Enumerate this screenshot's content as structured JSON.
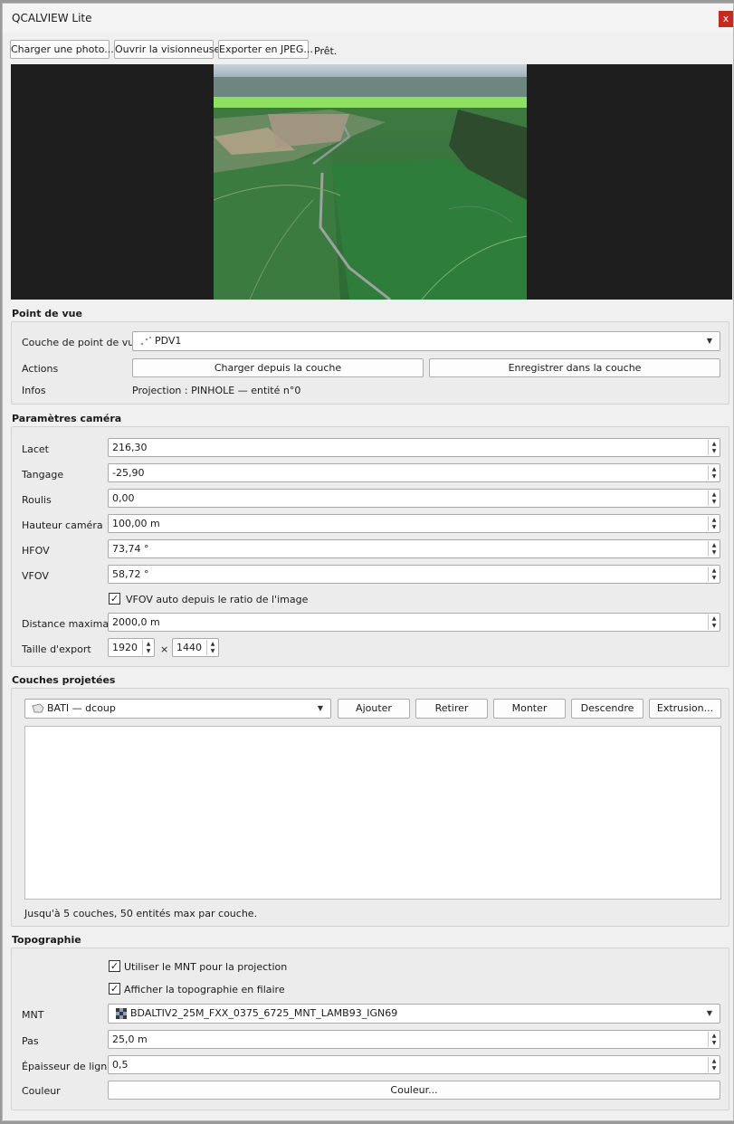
{
  "window": {
    "title": "QCALVIEW Lite",
    "close_label": "x"
  },
  "toolbar": {
    "load_photo_label": "Charger une photo...",
    "open_viewer_label": "Ouvrir la visionneuse",
    "export_jpeg_label": "Exporter en JPEG...",
    "status": "Prêt."
  },
  "viewpoint": {
    "section_title": "Point de vue",
    "layer_label": "Couche de point de vue",
    "layer_value": "PDV1",
    "actions_label": "Actions",
    "load_from_layer_label": "Charger depuis la couche",
    "save_to_layer_label": "Enregistrer dans la couche",
    "info_label": "Infos",
    "info_value": "Projection : PINHOLE — entité n°0"
  },
  "camera": {
    "section_title": "Paramètres caméra",
    "fields": [
      {
        "label": "Lacet",
        "value": "216,30"
      },
      {
        "label": "Tangage",
        "value": "-25,90"
      },
      {
        "label": "Roulis",
        "value": "0,00"
      },
      {
        "label": "Hauteur caméra",
        "value": "100,00 m"
      },
      {
        "label": "HFOV",
        "value": "73,74 °"
      },
      {
        "label": "VFOV",
        "value": "58,72 °"
      }
    ],
    "vfov_auto_label": "VFOV auto depuis le ratio de l'image",
    "vfov_auto_checked": true,
    "max_distance_label": "Distance maximale",
    "max_distance_value": "2000,0 m",
    "export_size_label": "Taille d'export",
    "export_width": "1920",
    "export_times": "×",
    "export_height": "1440"
  },
  "projected_layers": {
    "section_title": "Couches projetées",
    "layer_value": "BATI — dcoup",
    "add_label": "Ajouter",
    "remove_label": "Retirer",
    "up_label": "Monter",
    "down_label": "Descendre",
    "extrusion_label": "Extrusion...",
    "items": [],
    "note": "Jusqu'à 5 couches, 50 entités max par couche."
  },
  "topography": {
    "section_title": "Topographie",
    "use_dtm_label": "Utiliser le MNT pour la projection",
    "use_dtm_checked": true,
    "show_wireframe_label": "Afficher la topographie en filaire",
    "show_wireframe_checked": true,
    "dtm_label": "MNT",
    "dtm_value": "BDALTIV2_25M_FXX_0375_6725_MNT_LAMB93_IGN69",
    "step_label": "Pas",
    "step_value": "25,0 m",
    "line_width_label": "Épaisseur de ligne",
    "line_width_value": "0,5",
    "color_label": "Couleur",
    "color_button_label": "Couleur..."
  },
  "icons": {
    "point_layer": "point-layer-icon",
    "polygon_layer": "polygon-layer-icon",
    "raster_layer": "raster-layer-icon",
    "dropdown": "chevron-down-icon",
    "spin": "spin-arrows-icon",
    "check": "checkmark-icon"
  },
  "colors": {
    "window_bg": "#f0f0f0",
    "close_button": "#c42b1c",
    "photo_panel_bg": "#1e1e1e",
    "field_border": "#a9a9a9"
  }
}
